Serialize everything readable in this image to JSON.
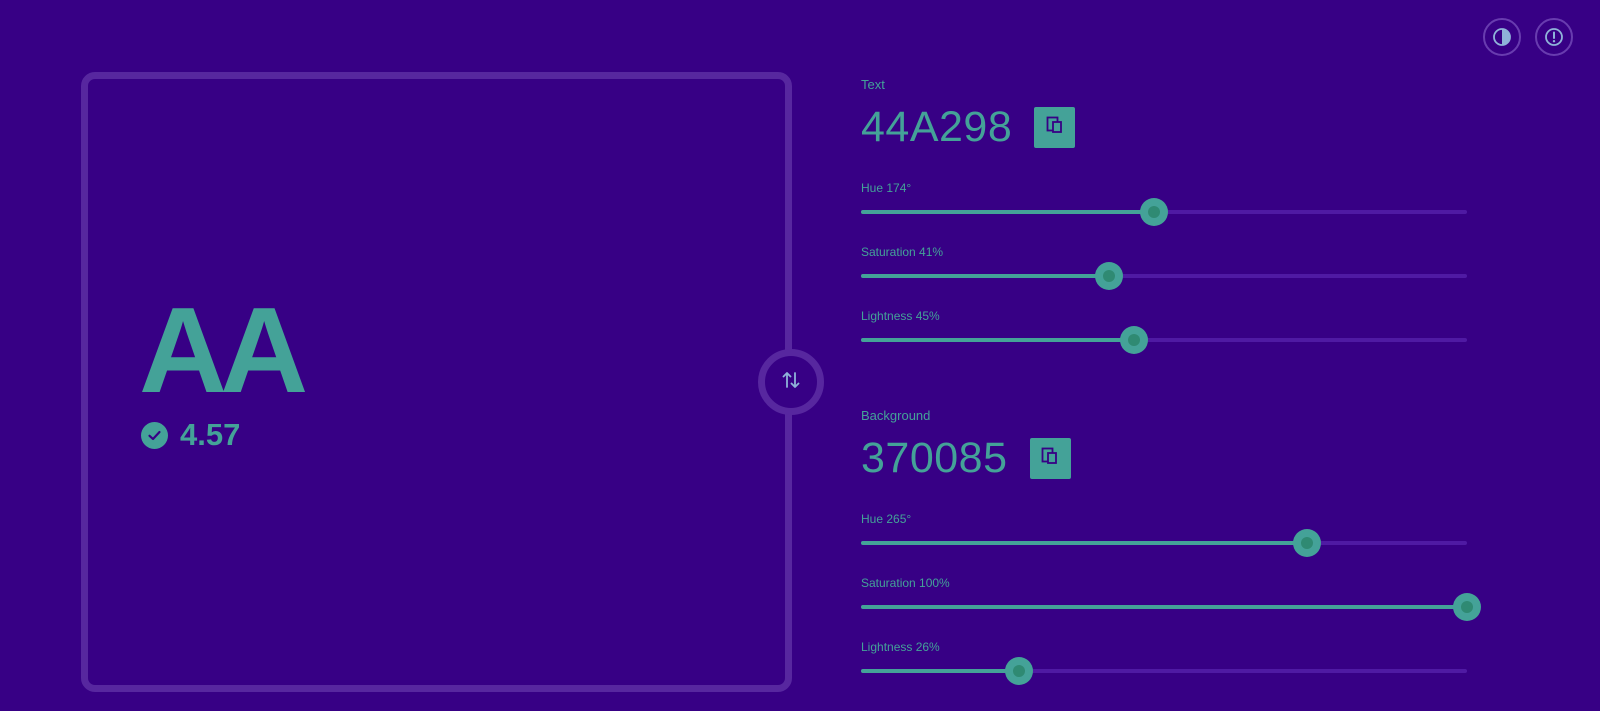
{
  "header": {
    "contrast_icon": "contrast-icon",
    "info_icon": "info-icon"
  },
  "preview": {
    "sample_text": "AA",
    "ratio": "4.57",
    "pass_icon": "check-circle-icon",
    "swap_icon": "swap-vertical-icon"
  },
  "text_color": {
    "label": "Text",
    "hex": "44A298",
    "copy_icon": "copy-icon",
    "sliders": [
      {
        "label": "Hue 174°",
        "value": 174,
        "max": 360
      },
      {
        "label": "Saturation 41%",
        "value": 41,
        "max": 100
      },
      {
        "label": "Lightness 45%",
        "value": 45,
        "max": 100
      }
    ]
  },
  "background_color": {
    "label": "Background",
    "hex": "370085",
    "copy_icon": "copy-icon",
    "sliders": [
      {
        "label": "Hue 265°",
        "value": 265,
        "max": 360
      },
      {
        "label": "Saturation 100%",
        "value": 100,
        "max": 100
      },
      {
        "label": "Lightness 26%",
        "value": 26,
        "max": 100
      }
    ]
  },
  "colors": {
    "foreground": "#44a298",
    "background": "#370085",
    "border": "#57279f",
    "track": "#4f1aa3"
  }
}
